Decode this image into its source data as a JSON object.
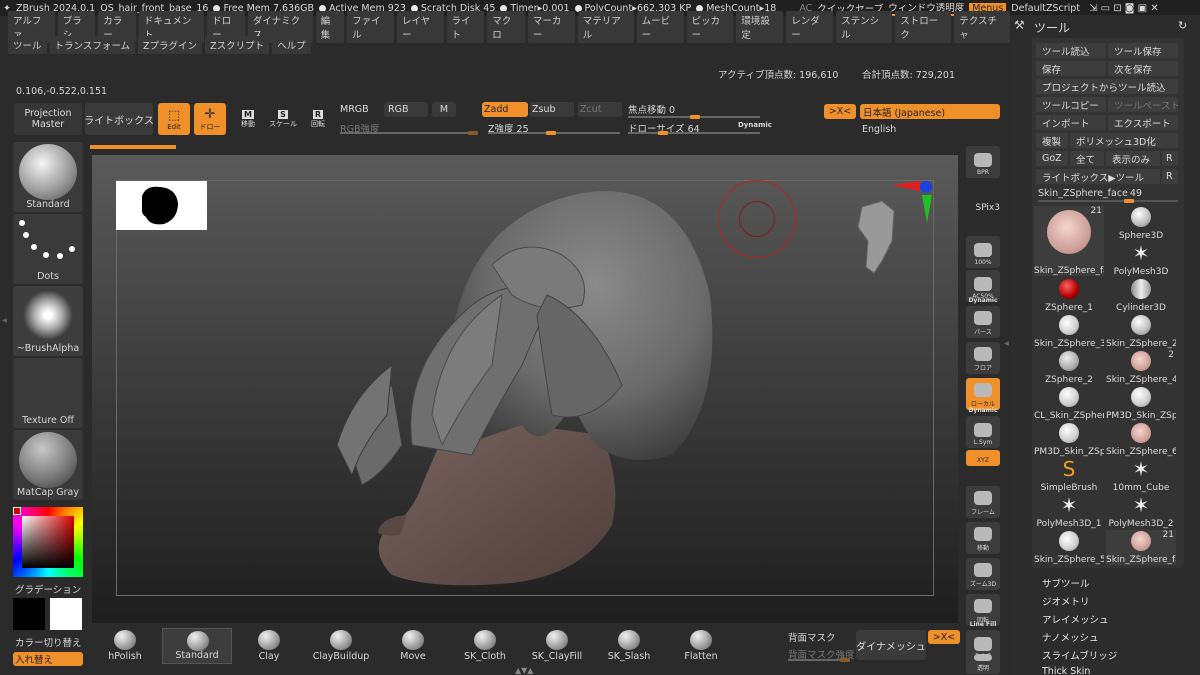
{
  "menubar": {
    "app": "ZBrush 2024.0.1",
    "file": "QS_hair_front_base_16",
    "free_mem": "Free Mem 7.636GB",
    "active_mem": "Active Mem 923",
    "scratch": "Scratch Disk 45",
    "timer": "Timer▸0.001",
    "polycount": "PolyCount▸662.303 KP",
    "meshcount": "MeshCount▸18",
    "ac": "AC",
    "quicksave": "クイックセーブ",
    "transparency": "ウィンドウ透明度",
    "menus": "Menus",
    "script": "DefaultZScript"
  },
  "main_menu": {
    "row1": [
      "アルファ",
      "ブラシ",
      "カラー",
      "ドキュメント",
      "ドロー",
      "ダイナミクス",
      "編集",
      "ファイル",
      "レイヤー",
      "ライト",
      "マクロ",
      "マーカー",
      "マテリアル",
      "ムービー",
      "ピッカー",
      "環境設定",
      "レンダー",
      "ステンシル",
      "ストローク",
      "テクスチャ"
    ],
    "row2": [
      "ツール",
      "トランスフォーム",
      "Zプラグイン",
      "Zスクリプト",
      "ヘルプ"
    ]
  },
  "info": {
    "coords": "0.106,-0.522,0.151",
    "active_points": "アクティブ頂点数: 196,610",
    "total_points": "合計頂点数: 729,201"
  },
  "top_shelf": {
    "projection_master_1": "Projection",
    "projection_master_2": "Master",
    "lightbox": "ライトボックス",
    "edit": "Edit",
    "draw": "ドロー",
    "move": "移動",
    "scale": "スケール",
    "rotate": "回転",
    "mrgb": "MRGB",
    "rgb": "RGB",
    "m": "M",
    "rgb_intensity": "RGB強度",
    "zadd": "Zadd",
    "zsub": "Zsub",
    "zcut": "Zcut",
    "z_intensity_label": "Z強度",
    "z_intensity": "25",
    "focal_shift_label": "焦点移動",
    "focal_shift": "0",
    "draw_size_label": "ドローサイズ",
    "draw_size": "64",
    "dynamic": "Dynamic",
    "x_btn": ">X<",
    "language": "日本語 (Japanese)",
    "english": "English"
  },
  "left_shelf": {
    "brush": "Standard",
    "stroke": "Dots",
    "alpha": "~BrushAlpha",
    "texture": "Texture Off",
    "material": "MatCap Gray",
    "gradient": "グラデーション",
    "swap_color": "カラー切り替え",
    "swap": "入れ替え"
  },
  "right_shelf": [
    {
      "label": "BPR"
    },
    {
      "label": "SPix",
      "value": "3"
    },
    {
      "label": "100%"
    },
    {
      "label": "AC50%"
    },
    {
      "label": "パース",
      "top": "Dynamic"
    },
    {
      "label": "フロア"
    },
    {
      "label": "ローカル"
    },
    {
      "label": "L.Sym",
      "top": "Dynamic"
    },
    {
      "label": "XYZ"
    },
    {
      "label": "フレーム"
    },
    {
      "label": "移動"
    },
    {
      "label": "ズーム3D"
    },
    {
      "label": "回転"
    },
    {
      "label": "PolyF",
      "top": "Line Fill"
    },
    {
      "label": "透明"
    }
  ],
  "tool_panel": {
    "title": "ツール",
    "load_tool": "ツール読込",
    "save_tool_as": "ツール保存",
    "save": "保存",
    "save_as": "次を保存",
    "load_from_project": "プロジェクトからツール読込",
    "copy_tool": "ツールコピー",
    "paste_tool": "ツールペースト",
    "import": "インポート",
    "export": "エクスポート",
    "clone": "複製",
    "make_polymesh": "ポリメッシュ3D化",
    "goz": "GoZ",
    "all": "全て",
    "visible": "表示のみ",
    "r": "R",
    "lightbox_tools": "ライトボックス▶ツール",
    "current_tool": "Skin_ZSphere_face",
    "current_value": "49",
    "tools": [
      {
        "label": "Skin_ZSphere_fa",
        "badge": "21",
        "type": "face"
      },
      {
        "label": "Sphere3D",
        "type": "sphere"
      },
      {
        "label": "PolyMesh3D",
        "type": "star"
      },
      {
        "label": "ZSphere_1",
        "type": "red"
      },
      {
        "label": "Cylinder3D",
        "type": "cyl"
      },
      {
        "label": "Skin_ZSphere_3",
        "type": "feather"
      },
      {
        "label": "Skin_ZSphere_2",
        "type": "sphere"
      },
      {
        "label": "ZSphere_2",
        "type": "rock"
      },
      {
        "label": "Skin_ZSphere_4",
        "badge": "2",
        "type": "face"
      },
      {
        "label": "CL_Skin_ZSpher",
        "type": "blob"
      },
      {
        "label": "PM3D_Skin_ZSp",
        "type": "blob"
      },
      {
        "label": "PM3D_Skin_ZSp",
        "type": "blob"
      },
      {
        "label": "Skin_ZSphere_6",
        "type": "face"
      },
      {
        "label": "SimpleBrush",
        "type": "simple"
      },
      {
        "label": "10mm_Cube",
        "type": "star"
      },
      {
        "label": "PolyMesh3D_1",
        "type": "star"
      },
      {
        "label": "PolyMesh3D_2",
        "type": "star"
      },
      {
        "label": "Skin_ZSphere_5",
        "type": "feather"
      },
      {
        "label": "Skin_ZSphere_fa",
        "badge": "21",
        "type": "face"
      }
    ],
    "subpalettes": [
      "サブツール",
      "ジオメトリ",
      "アレイメッシュ",
      "ナノメッシュ",
      "スライムブリッジ",
      "Thick Skin"
    ]
  },
  "bottom_shelf": {
    "brushes": [
      "hPolish",
      "Standard",
      "Clay",
      "ClayBuildup",
      "Move",
      "SK_Cloth",
      "SK_ClayFill",
      "SK_Slash",
      "Flatten"
    ],
    "back_mask": "背面マスク",
    "back_mask_intensity": "背面マスク強度",
    "dynamesh": "ダイナメッシュ",
    "x_btn": ">X<"
  }
}
